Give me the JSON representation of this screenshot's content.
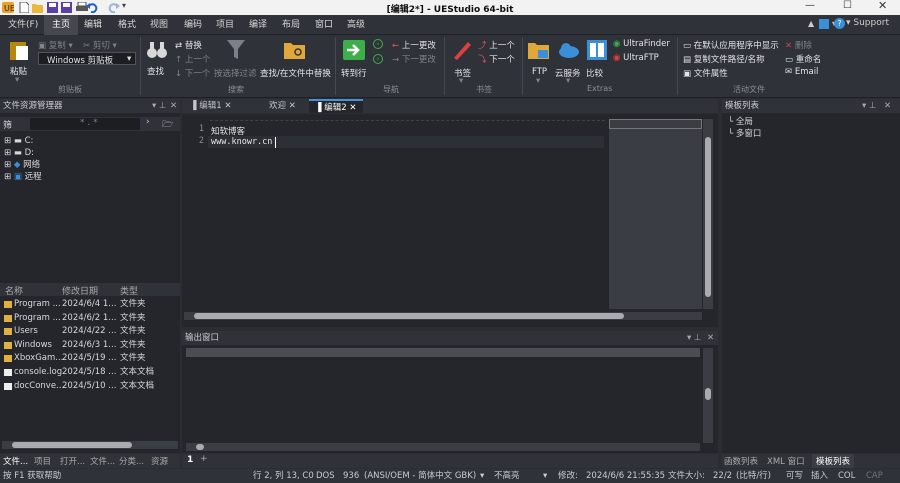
{
  "title": "[编辑2*] - UEStudio 64-bit",
  "menu": [
    "文件(F)",
    "主页",
    "编辑",
    "格式",
    "视图",
    "编码",
    "项目",
    "编译",
    "布局",
    "窗口",
    "高级"
  ],
  "menu_right": {
    "support": "Support"
  },
  "ribbon": {
    "paste": "粘贴",
    "copy": "复制",
    "cut": "剪切",
    "clipboard_select": "Windows 剪贴板",
    "group_clipboard": "剪贴板",
    "find": "查找",
    "replace": "替换",
    "prev": "上一个",
    "next": "下一个",
    "filter": "按选择过滤",
    "find_in_files": "查找/在文件中替换",
    "group_search": "搜索",
    "goto": "转到行",
    "prev_change": "上一更改",
    "next_change": "下一更改",
    "group_nav": "导航",
    "bookmark": "书签",
    "bm_prev": "上一个",
    "bm_next": "下一个",
    "group_bookmark": "书签",
    "ftp": "FTP",
    "cloud": "云服务",
    "compare": "比较",
    "ultrafinder": "UltraFinder",
    "ultraftp": "UltraFTP",
    "group_extras": "Extras",
    "open_default": "在默认应用程序中显示",
    "copy_path": "复制文件路径/名称",
    "file_props": "文件属性",
    "delete": "删除",
    "rename": "重命名",
    "email": "Email",
    "group_active": "活动文件"
  },
  "explorer": {
    "title": "文件资源管理器",
    "filter_label": "筛",
    "filter_value": "* . *",
    "tree": [
      {
        "label": "C:"
      },
      {
        "label": "D:"
      },
      {
        "label": "网络"
      },
      {
        "label": "远程"
      }
    ],
    "columns": [
      "名称",
      "修改日期",
      "类型"
    ],
    "files": [
      {
        "name": "Program ...",
        "date": "2024/6/4 1...",
        "type": "文件夹",
        "kind": "folder"
      },
      {
        "name": "Program ...",
        "date": "2024/6/2 1...",
        "type": "文件夹",
        "kind": "folder"
      },
      {
        "name": "Users",
        "date": "2024/4/22 ...",
        "type": "文件夹",
        "kind": "folder"
      },
      {
        "name": "Windows",
        "date": "2024/6/3 1...",
        "type": "文件夹",
        "kind": "folder"
      },
      {
        "name": "XboxGam...",
        "date": "2024/5/19 ...",
        "type": "文件夹",
        "kind": "folder"
      },
      {
        "name": "console.log",
        "date": "2024/5/18 ...",
        "type": "文本文档",
        "kind": "file"
      },
      {
        "name": "docConve...",
        "date": "2024/5/10 ...",
        "type": "文本文档",
        "kind": "file"
      }
    ]
  },
  "editor": {
    "tabs": [
      "编辑1",
      "欢迎",
      "编辑2"
    ],
    "lines": [
      "知软博客",
      "www.knowr.cn"
    ],
    "line_numbers": [
      "1",
      "2"
    ]
  },
  "output": {
    "title": "输出窗口"
  },
  "templates": {
    "title": "模板列表",
    "items": [
      "全局",
      "多窗口"
    ]
  },
  "bottom_left_tabs": [
    "文件...",
    "项目",
    "打开...",
    "文件...",
    "分类...",
    "资源"
  ],
  "bottom_right_tabs": [
    "函数列表",
    "XML 窗口",
    "模板列表"
  ],
  "doc_tab": "1",
  "status": {
    "help": "按 F1 获取帮助",
    "pos": "行 2, 列 13, C0",
    "eol": "DOS",
    "codepage": "936",
    "encoding": "(ANSI/OEM - 简体中文 GBK)",
    "highlight": "不高亮",
    "modified": "修改:",
    "modified_date": "2024/6/6 21:55:35",
    "filesize": "文件大小:",
    "filesize_value": "22/2",
    "ratio": "(比特/行)",
    "mode_rw": "可写",
    "mode_ins": "插入",
    "col": "COL",
    "cap": "CAP"
  }
}
